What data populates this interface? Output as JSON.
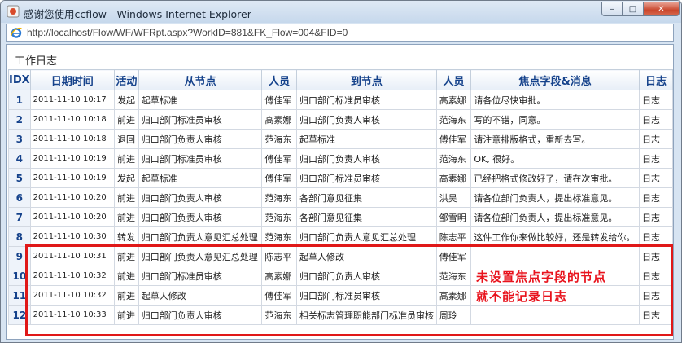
{
  "window": {
    "title": "感谢您使用ccflow - Windows Internet Explorer",
    "url": "http://localhost/Flow/WF/WFRpt.aspx?WorkID=881&FK_Flow=004&FID=0",
    "buttons": {
      "minimize": "–",
      "maximize": "□",
      "close": "✕"
    }
  },
  "page": {
    "title": "工作日志"
  },
  "table": {
    "headers": [
      "IDX",
      "日期时间",
      "活动",
      "从节点",
      "人员",
      "到节点",
      "人员",
      "焦点字段&消息",
      "日志"
    ],
    "rows": [
      {
        "idx": "1",
        "date": "2011-11-10 10:17",
        "action": "发起",
        "from": "起草标准",
        "from_user": "傅佳军",
        "to": "归口部门标准员审核",
        "to_user": "高素娜",
        "msg": "请各位尽快审批。",
        "log": "日志"
      },
      {
        "idx": "2",
        "date": "2011-11-10 10:18",
        "action": "前进",
        "from": "归口部门标准员审核",
        "from_user": "高素娜",
        "to": "归口部门负责人审核",
        "to_user": "范海东",
        "msg": "写的不错，同意。",
        "log": "日志"
      },
      {
        "idx": "3",
        "date": "2011-11-10 10:18",
        "action": "退回",
        "from": "归口部门负责人审核",
        "from_user": "范海东",
        "to": "起草标准",
        "to_user": "傅佳军",
        "msg": "请注意排版格式，重新去写。",
        "log": "日志"
      },
      {
        "idx": "4",
        "date": "2011-11-10 10:19",
        "action": "前进",
        "from": "归口部门标准员审核",
        "from_user": "傅佳军",
        "to": "归口部门负责人审核",
        "to_user": "范海东",
        "msg": "OK, 很好。",
        "log": "日志"
      },
      {
        "idx": "5",
        "date": "2011-11-10 10:19",
        "action": "发起",
        "from": "起草标准",
        "from_user": "傅佳军",
        "to": "归口部门标准员审核",
        "to_user": "高素娜",
        "msg": "已经把格式修改好了，请在次审批。",
        "log": "日志"
      },
      {
        "idx": "6",
        "date": "2011-11-10 10:20",
        "action": "前进",
        "from": "归口部门负责人审核",
        "from_user": "范海东",
        "to": "各部门意见征集",
        "to_user": "洪昊",
        "msg": "请各位部门负责人，提出标准意见。",
        "log": "日志"
      },
      {
        "idx": "7",
        "date": "2011-11-10 10:20",
        "action": "前进",
        "from": "归口部门负责人审核",
        "from_user": "范海东",
        "to": "各部门意见征集",
        "to_user": "邹雪明",
        "msg": "请各位部门负责人，提出标准意见。",
        "log": "日志"
      },
      {
        "idx": "8",
        "date": "2011-11-10 10:30",
        "action": "转发",
        "from": "归口部门负责人意见汇总处理",
        "from_user": "范海东",
        "to": "归口部门负责人意见汇总处理",
        "to_user": "陈志平",
        "msg": "这件工作你来做比较好，还是转发给你。",
        "log": "日志"
      },
      {
        "idx": "9",
        "date": "2011-11-10 10:31",
        "action": "前进",
        "from": "归口部门负责人意见汇总处理",
        "from_user": "陈志平",
        "to": "起草人修改",
        "to_user": "傅佳军",
        "msg": "",
        "log": "日志"
      },
      {
        "idx": "10",
        "date": "2011-11-10 10:32",
        "action": "前进",
        "from": "归口部门标准员审核",
        "from_user": "高素娜",
        "to": "归口部门负责人审核",
        "to_user": "范海东",
        "msg": "",
        "log": "日志"
      },
      {
        "idx": "11",
        "date": "2011-11-10 10:32",
        "action": "前进",
        "from": "起草人修改",
        "from_user": "傅佳军",
        "to": "归口部门标准员审核",
        "to_user": "高素娜",
        "msg": "",
        "log": "日志"
      },
      {
        "idx": "12",
        "date": "2011-11-10 10:33",
        "action": "前进",
        "from": "归口部门负责人审核",
        "from_user": "范海东",
        "to": "相关标志管理职能部门标准员审核",
        "to_user": "周玲",
        "msg": "",
        "log": "日志"
      }
    ]
  },
  "annotation": {
    "line1": "未设置焦点字段的节点",
    "line2": "就不能记录日志",
    "color": "#e8131d"
  }
}
